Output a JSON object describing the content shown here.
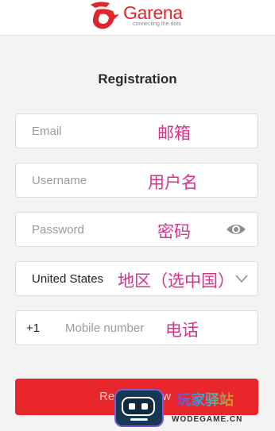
{
  "header": {
    "brand": "Garena",
    "tagline": "connecting the dots"
  },
  "page": {
    "title": "Registration"
  },
  "form": {
    "email": {
      "placeholder": "Email",
      "annotation": "邮箱"
    },
    "username": {
      "placeholder": "Username",
      "annotation": "用户名"
    },
    "password": {
      "placeholder": "Password",
      "annotation": "密码"
    },
    "country": {
      "value": "United States",
      "annotation": "地区（选中国）"
    },
    "mobile": {
      "country_code": "+1",
      "placeholder": "Mobile number",
      "annotation": "电话"
    }
  },
  "actions": {
    "register_label": "Register Now"
  },
  "watermark": {
    "cn": "玩家驿站",
    "en": "WODEGAME.CN"
  },
  "colors": {
    "brand_red": "#e0262b",
    "annotation_pink": "#d8318a",
    "button_red": "#e8262c"
  }
}
